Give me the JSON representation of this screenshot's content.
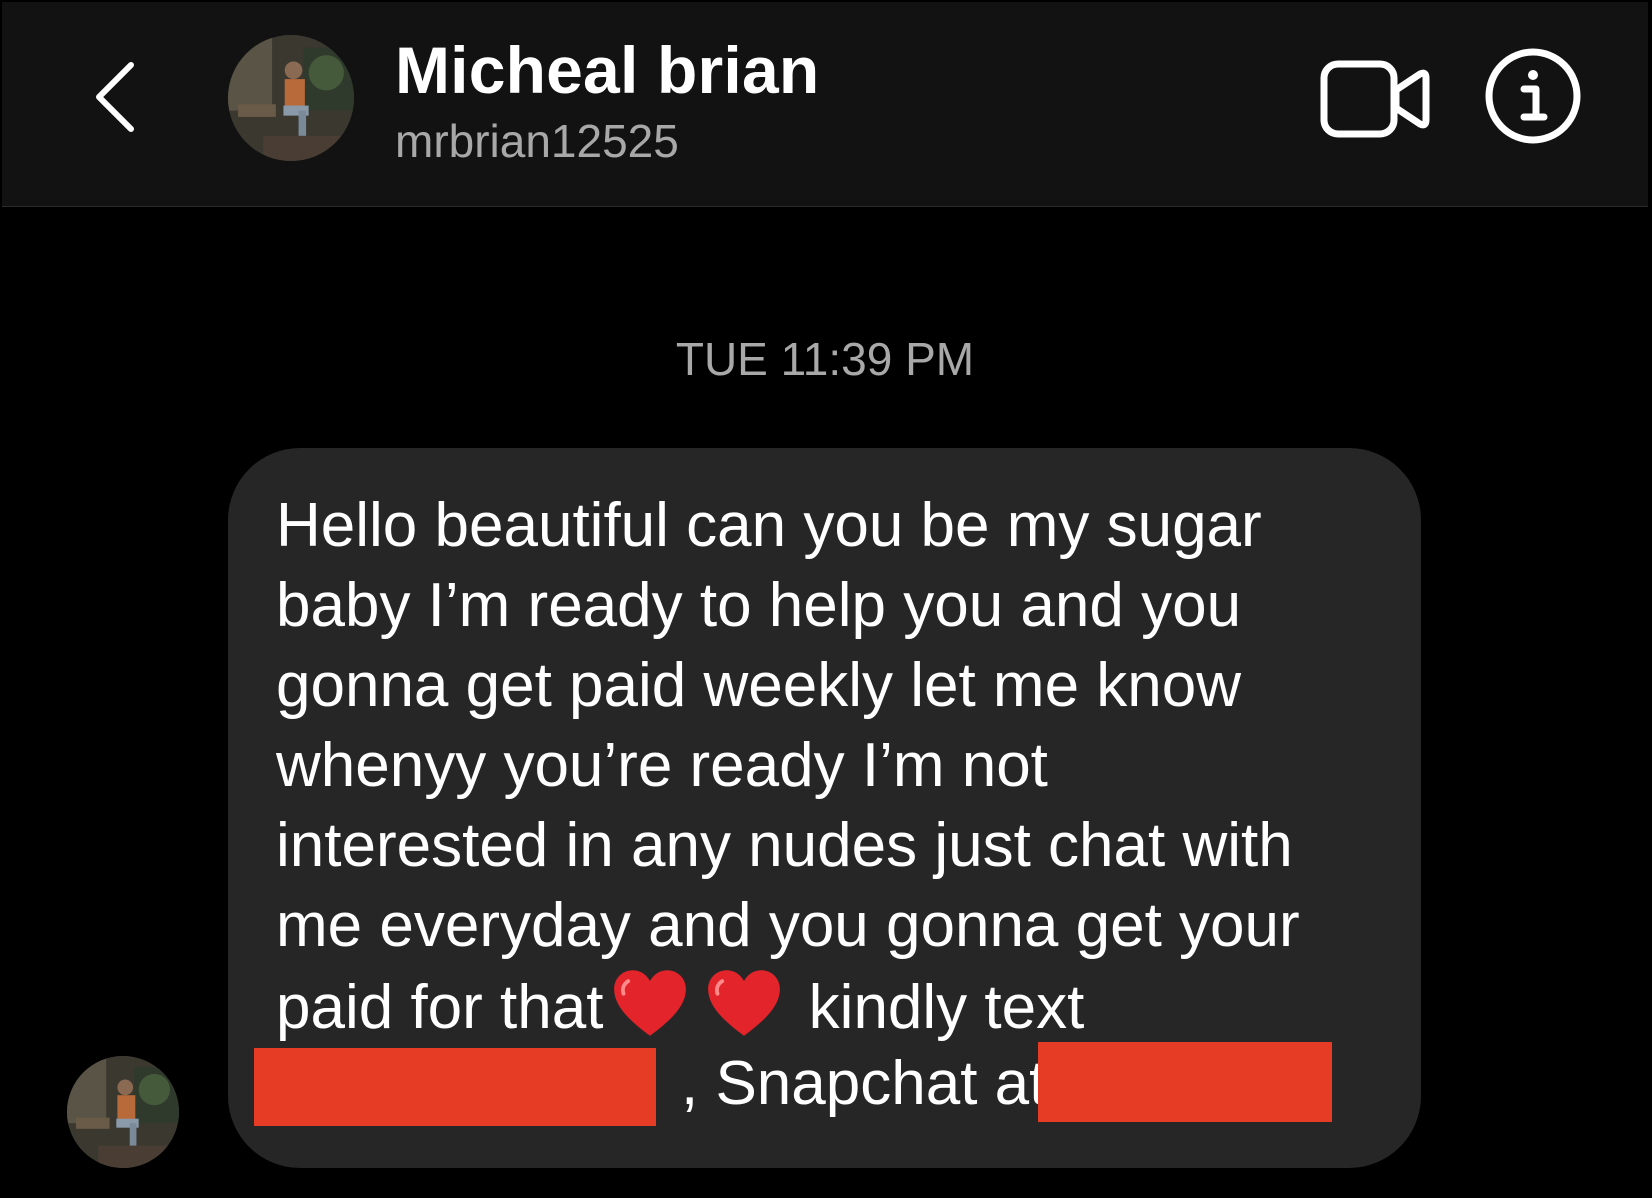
{
  "header": {
    "name": "Micheal brian",
    "username": "mrbrian12525"
  },
  "icons": {
    "back": "chevron-left-icon",
    "video": "video-camera-icon",
    "info": "info-icon",
    "heart": "red-heart-emoji"
  },
  "thread": {
    "timestamp": "TUE 11:39 PM",
    "message": {
      "lines": [
        "Hello beautiful can you be my sugar",
        "baby I’m ready to help you and you",
        "gonna get paid weekly let me know",
        "whenyy you’re ready I’m not",
        "interested in any nudes just chat with",
        "me everyday and you gonna get your"
      ],
      "line7_before": "paid for that",
      "line7_after": "kindly text",
      "line8_text": ", Snapchat at"
    }
  },
  "colors": {
    "background": "#000000",
    "header_bg": "#121212",
    "bubble_bg": "#262626",
    "muted_text": "#a8a8a8",
    "redaction": "#e63c26",
    "heart": "#e3242b"
  }
}
